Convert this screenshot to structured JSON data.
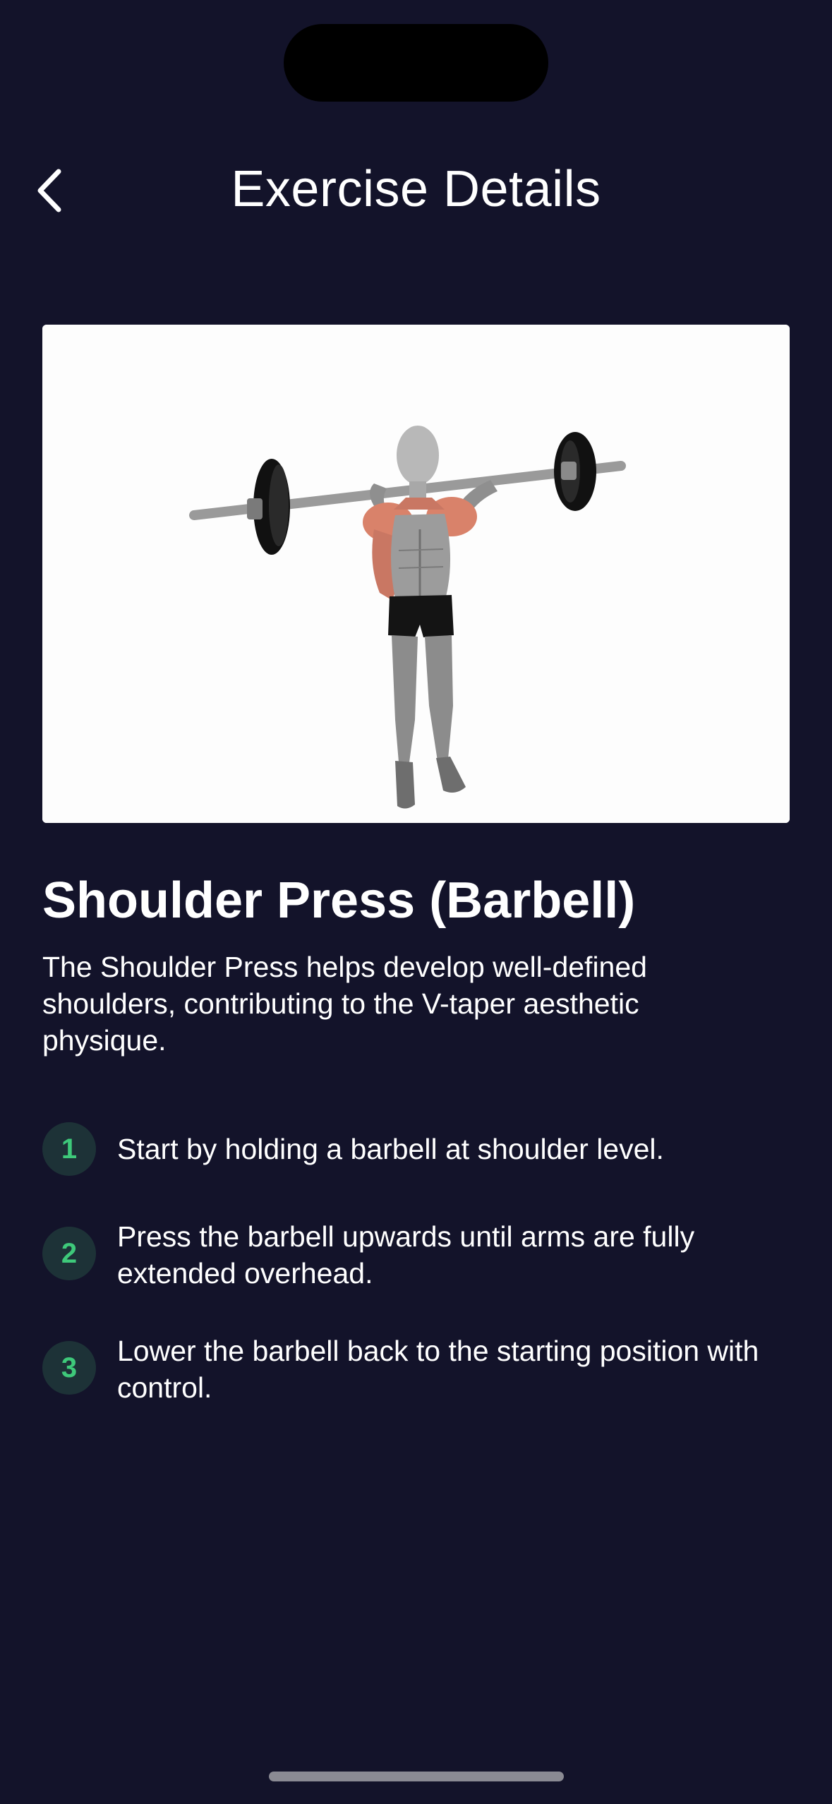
{
  "header": {
    "title": "Exercise Details",
    "back_icon": "chevron-left-icon"
  },
  "exercise": {
    "name": "Shoulder Press (Barbell)",
    "description": "The Shoulder Press helps develop well-defined shoulders, contributing to the V-taper aesthetic physique.",
    "image_subject": "barbell shoulder press illustration"
  },
  "steps": [
    {
      "number": "1",
      "text": "Start by holding a barbell at shoulder level."
    },
    {
      "number": "2",
      "text": "Press the barbell upwards until arms are fully extended overhead."
    },
    {
      "number": "3",
      "text": "Lower the barbell back to the starting position with control."
    }
  ],
  "colors": {
    "background": "#13132a",
    "step_badge_bg": "#1d3237",
    "step_badge_text": "#3ec97a",
    "text": "#ffffff"
  }
}
